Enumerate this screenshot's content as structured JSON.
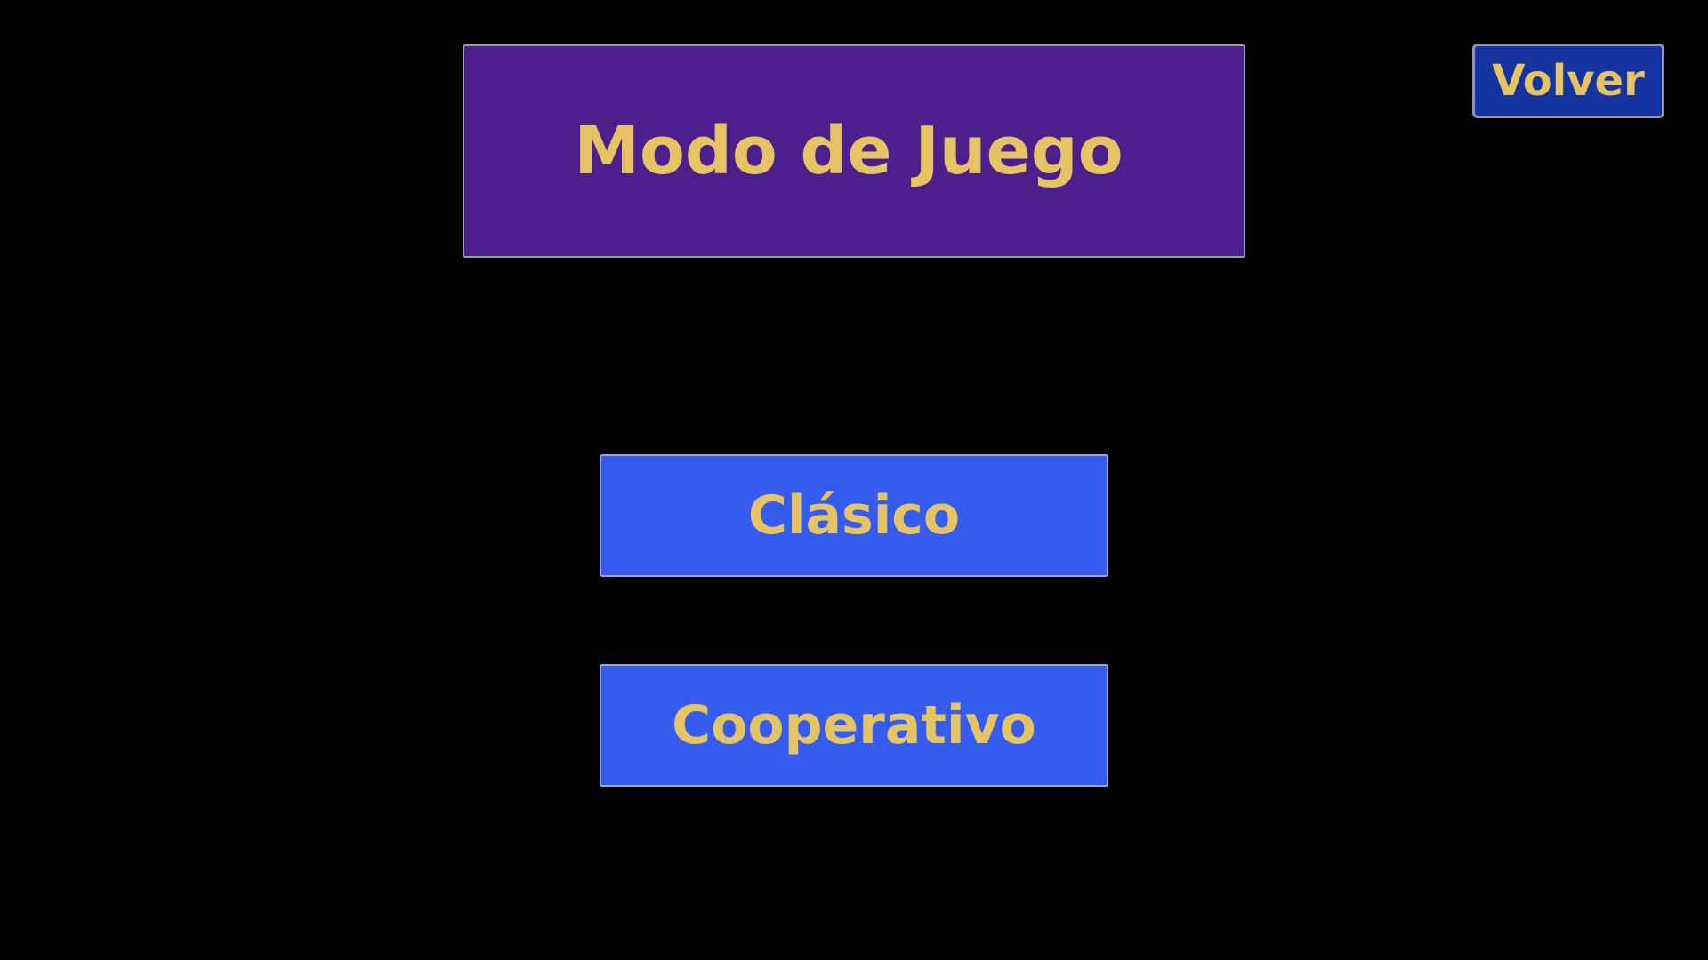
{
  "title": "Modo de Juego",
  "back_button": {
    "label": "Volver"
  },
  "modes": [
    {
      "label": "Clásico"
    },
    {
      "label": "Cooperativo"
    }
  ],
  "colors": {
    "background": "#000000",
    "title_panel": "#4b208c",
    "mode_button": "#355cee",
    "back_button": "#1634a0",
    "text_gold": "#e6c463"
  }
}
